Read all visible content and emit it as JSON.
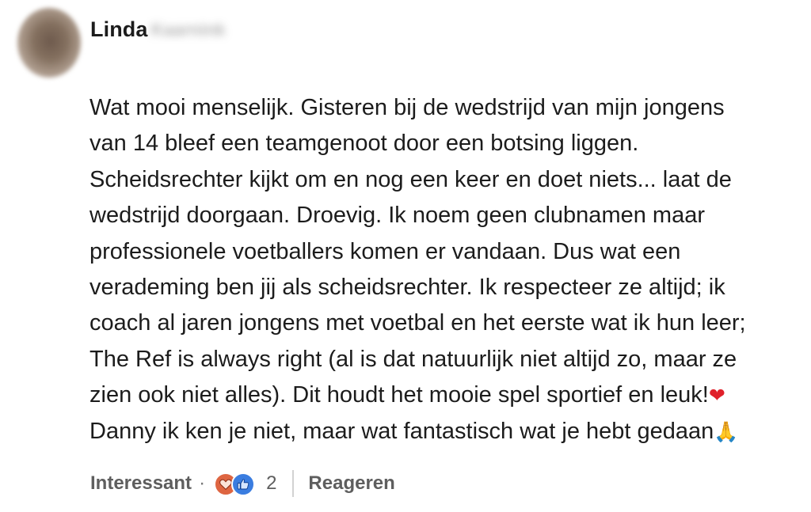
{
  "author": {
    "first_name": "Linda",
    "last_name": "Kaarnink"
  },
  "comment": {
    "lines": [
      "Wat mooi menselijk. Gisteren bij de wedstrijd van mijn jongens",
      "van 14 bleef een teamgenoot door een botsing liggen.",
      "Scheidsrechter kijkt om en nog een keer en doet niets... laat de",
      "wedstrijd doorgaan. Droevig. Ik noem geen clubnamen maar",
      "professionele voetballers komen er vandaan. Dus wat een",
      "verademing ben jij als scheidsrechter. Ik respecteer ze altijd; ik",
      "coach al jaren jongens met voetbal en het eerste wat ik hun leer;",
      "The Ref is always right (al is dat natuurlijk niet altijd zo, maar ze",
      "zien ook niet alles). Dit houdt het mooie spel sportief en leuk!",
      "Danny ik ken je niet, maar wat fantastisch wat je hebt gedaan"
    ],
    "emoji_heart": "❤",
    "emoji_pray": "🙏"
  },
  "actions": {
    "reaction_label": "Interessant",
    "separator": "·",
    "reaction_count": "2",
    "reply_label": "Reageren",
    "reaction_icons": [
      "love-reaction-icon",
      "like-reaction-icon"
    ]
  },
  "colors": {
    "love_reaction": "#de6541",
    "like_reaction": "#3a7de0",
    "heart_emoji": "#e0202a"
  }
}
